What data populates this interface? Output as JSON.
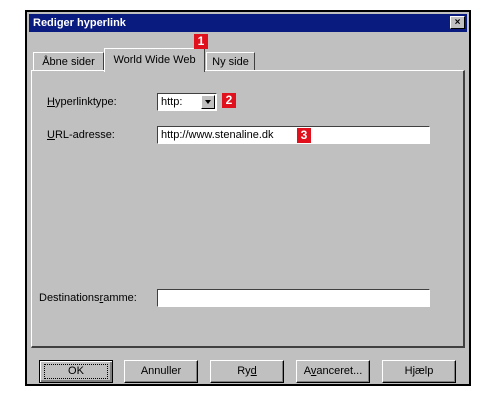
{
  "window": {
    "title": "Rediger hyperlink",
    "close_glyph": "×"
  },
  "tabs": [
    {
      "label": "Åbne sider"
    },
    {
      "label": "World Wide Web"
    },
    {
      "label": "Ny side"
    }
  ],
  "badges": [
    "1",
    "2",
    "3"
  ],
  "form": {
    "type_label_prefix": "",
    "type_label_ul": "H",
    "type_label_rest": "yperlinktype:",
    "type_value": "http:",
    "url_label_ul": "U",
    "url_label_rest": "RL-adresse:",
    "url_value": "http://www.stenaline.dk",
    "dest_label_prefix": "Destinations",
    "dest_label_ul": "r",
    "dest_label_rest": "amme:",
    "dest_value": ""
  },
  "buttons": {
    "ok": "OK",
    "cancel": "Annuller",
    "clear_prefix": "Ry",
    "clear_ul": "d",
    "advanced_prefix": "A",
    "advanced_ul": "v",
    "advanced_rest": "anceret...",
    "help": "Hjælp"
  },
  "colors": {
    "titlebar": "#0a1b80",
    "dialog": "#c0c0c0",
    "badge": "#e0101c"
  }
}
